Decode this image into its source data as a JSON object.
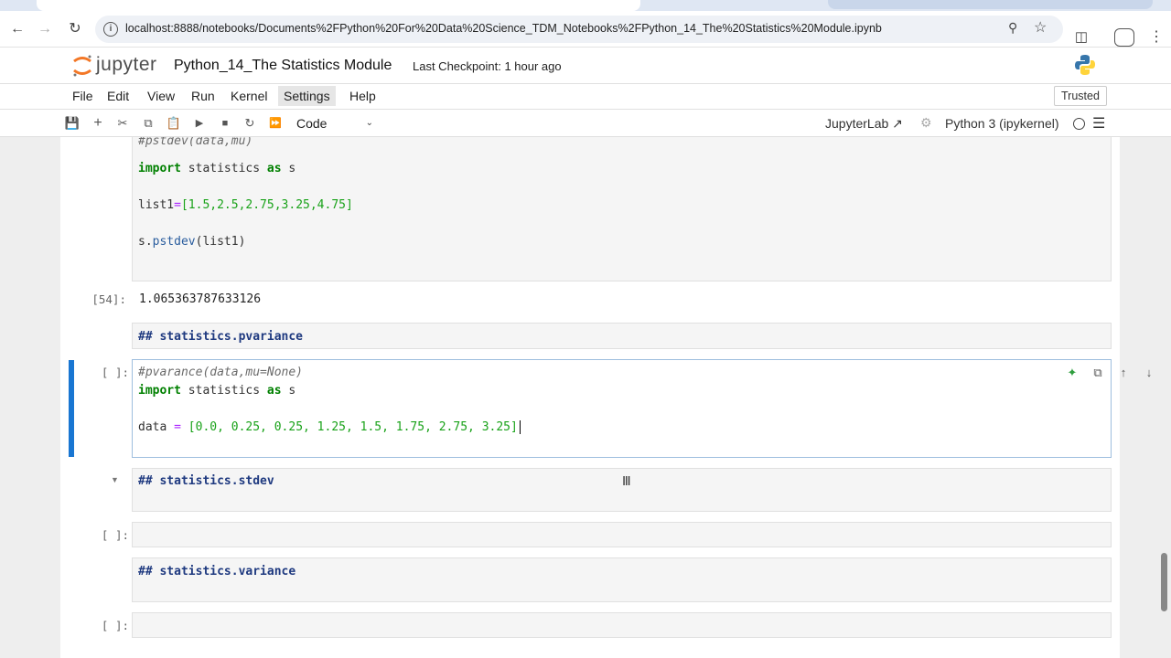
{
  "browser": {
    "url": "localhost:8888/notebooks/Documents%2FPython%20For%20Data%20Science_TDM_Notebooks%2FPython_14_The%20Statistics%20Module.ipynb"
  },
  "header": {
    "logo_text": "jupyter",
    "notebook_title": "Python_14_The Statistics Module",
    "checkpoint": "Last Checkpoint: 1 hour ago"
  },
  "menubar": {
    "items": [
      "File",
      "Edit",
      "View",
      "Run",
      "Kernel",
      "Settings",
      "Help"
    ],
    "trusted": "Trusted"
  },
  "toolbar": {
    "cell_type": "Code",
    "jupyterlab_link": "JupyterLab",
    "kernel": "Python 3 (ipykernel)"
  },
  "cells": {
    "c1": {
      "line1": "#pstdev(data,mu)",
      "line2_kw1": "import",
      "line2_mid": " statistics ",
      "line2_kw2": "as",
      "line2_end": " s",
      "line3_var": "list1",
      "line3_op": "=",
      "line3_list": "[1.5,2.5,2.75,3.25,4.75]",
      "line4_obj": "s.",
      "line4_fn": "pstdev",
      "line4_args": "(list1)"
    },
    "out54": {
      "prompt": "[54]:",
      "text": "1.065363787633126"
    },
    "md1": {
      "text": "## statistics.pvariance"
    },
    "c2": {
      "prompt": "[ ]:",
      "line1": "#pvarance(data,mu=None)",
      "line2_kw1": "import",
      "line2_mid": " statistics ",
      "line2_kw2": "as",
      "line2_end": " s",
      "line3_var": "data ",
      "line3_op": "=",
      "line3_list": " [0.0, 0.25, 0.25, 1.25, 1.5, 1.75, 2.75, 3.25]"
    },
    "md2": {
      "text": "## statistics.stdev"
    },
    "c3": {
      "prompt": "[ ]:"
    },
    "md3": {
      "text": "## statistics.variance"
    },
    "c4": {
      "prompt": "[ ]:"
    }
  },
  "colors": {
    "accent": "#1976d2",
    "keyword": "#008000",
    "number": "#19a219",
    "markdown_heading": "#1f3a80"
  }
}
